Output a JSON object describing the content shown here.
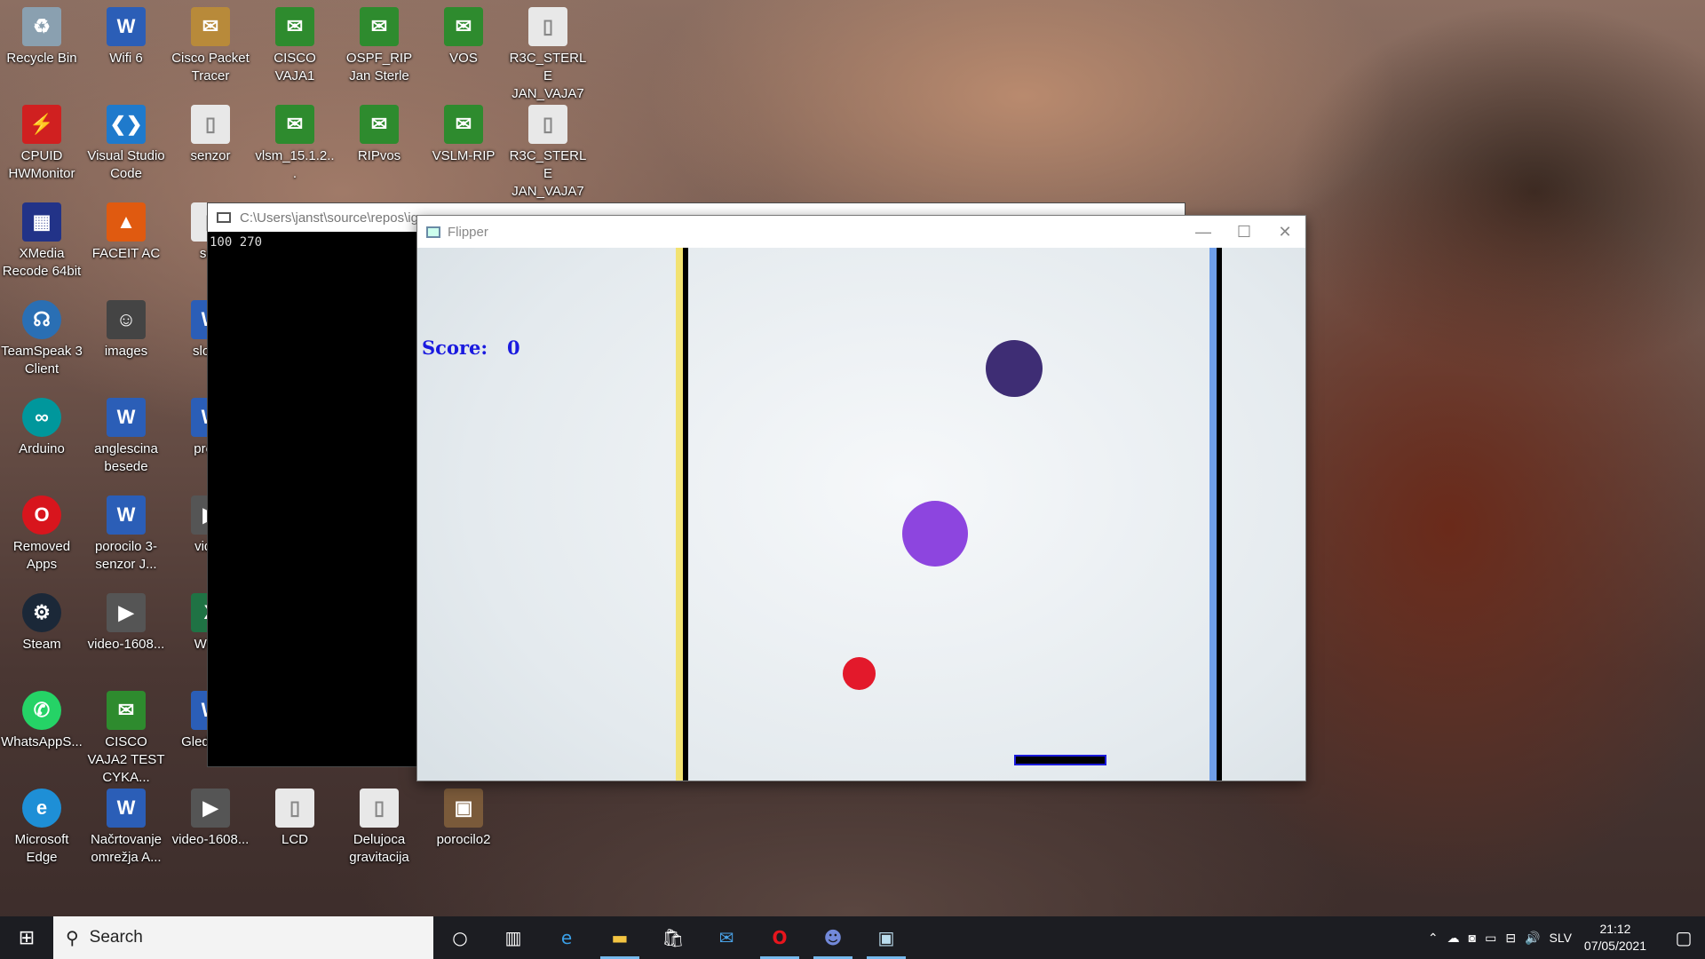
{
  "desktop": {
    "icons": [
      {
        "label": "Recycle Bin",
        "icon": "recycle-bin-icon",
        "color": "#8aa0b0"
      },
      {
        "label": "Wifi 6",
        "icon": "word-doc-icon",
        "color": "#2b5eb7"
      },
      {
        "label": "Cisco Packet Tracer",
        "icon": "packet-tracer-icon",
        "color": "#b88a3a"
      },
      {
        "label": "CISCO VAJA1",
        "icon": "packet-file-icon",
        "color": "#2e8b2e"
      },
      {
        "label": "OSPF_RIP Jan Sterle",
        "icon": "packet-file-icon",
        "color": "#2e8b2e"
      },
      {
        "label": "VOS",
        "icon": "packet-file-icon",
        "color": "#2e8b2e"
      },
      {
        "label": "R3C_STERLE JAN_VAJA7",
        "icon": "file-icon",
        "color": "#e8e8e8"
      },
      {
        "label": "CPUID HWMonitor",
        "icon": "hwmonitor-icon",
        "color": "#d02020"
      },
      {
        "label": "Visual Studio Code",
        "icon": "vscode-icon",
        "color": "#1f7acc"
      },
      {
        "label": "senzor",
        "icon": "file-icon",
        "color": "#e8e8e8"
      },
      {
        "label": "vlsm_15.1.2...",
        "icon": "packet-file-icon",
        "color": "#2e8b2e"
      },
      {
        "label": "RIPvos",
        "icon": "packet-file-icon",
        "color": "#2e8b2e"
      },
      {
        "label": "VSLM-RIP",
        "icon": "packet-file-icon",
        "color": "#2e8b2e"
      },
      {
        "label": "R3C_STERLE JAN_VAJA7",
        "icon": "file-icon",
        "color": "#e8e8e8"
      },
      {
        "label": "XMedia Recode 64bit",
        "icon": "film-icon",
        "color": "#223388"
      },
      {
        "label": "FACEIT AC",
        "icon": "faceit-icon",
        "color": "#e05a10"
      },
      {
        "label": "sen",
        "icon": "file-icon",
        "color": "#e8e8e8"
      },
      {
        "label": "TeamSpeak 3 Client",
        "icon": "teamspeak-icon",
        "color": "#2a6fb4"
      },
      {
        "label": "images",
        "icon": "image-icon",
        "color": "#444"
      },
      {
        "label": "slover",
        "icon": "word-doc-icon",
        "color": "#2b5eb7"
      },
      {
        "label": "Arduino",
        "icon": "arduino-icon",
        "color": "#00979c"
      },
      {
        "label": "anglescina besede",
        "icon": "word-doc-icon",
        "color": "#2b5eb7"
      },
      {
        "label": "preve",
        "icon": "word-doc-icon",
        "color": "#2b5eb7"
      },
      {
        "label": "Removed Apps",
        "icon": "opera-icon",
        "color": "#d8151d"
      },
      {
        "label": "porocilo 3-senzor J...",
        "icon": "word-doc-icon",
        "color": "#2b5eb7"
      },
      {
        "label": "video",
        "icon": "video-icon",
        "color": "#555"
      },
      {
        "label": "Steam",
        "icon": "steam-icon",
        "color": "#1b2838"
      },
      {
        "label": "video-1608...",
        "icon": "video-icon",
        "color": "#555"
      },
      {
        "label": "WOR",
        "icon": "excel-icon",
        "color": "#1f7244"
      },
      {
        "label": "WhatsAppS...",
        "icon": "whatsapp-icon",
        "color": "#25d366"
      },
      {
        "label": "CISCO VAJA2 TEST CYKA...",
        "icon": "packet-file-icon",
        "color": "#2e8b2e"
      },
      {
        "label": "Gled pred",
        "icon": "word-doc-icon",
        "color": "#2b5eb7"
      },
      {
        "label": "Microsoft Edge",
        "icon": "edge-icon",
        "color": "#1e8fd6"
      },
      {
        "label": "Načrtovanje omrežja A...",
        "icon": "word-doc-icon",
        "color": "#2b5eb7"
      },
      {
        "label": "video-1608...",
        "icon": "video-icon",
        "color": "#555"
      },
      {
        "label": "LCD",
        "icon": "file-icon",
        "color": "#e8e8e8"
      },
      {
        "label": "Delujoca gravitacija",
        "icon": "file-icon",
        "color": "#e8e8e8"
      },
      {
        "label": "porocilo2",
        "icon": "image-icon",
        "color": "#7a5a3a"
      }
    ]
  },
  "console": {
    "title": "C:\\Users\\janst\\source\\repos\\ig",
    "output": "100 270"
  },
  "flipper": {
    "title": "Flipper",
    "score_label": "Score:",
    "score_value": "0",
    "left_rail_colors": [
      "#f2e271",
      "#000000"
    ],
    "right_rail_colors": [
      "#6f9ee8",
      "#000000"
    ],
    "balls": [
      {
        "name": "dark-ball",
        "color": "#3e2d74"
      },
      {
        "name": "purple-ball",
        "color": "#8d45df"
      },
      {
        "name": "red-ball",
        "color": "#e3192b"
      }
    ],
    "paddle_color": "#0a0a6a"
  },
  "taskbar": {
    "search_placeholder": "Search",
    "language": "SLV",
    "time": "21:12",
    "date": "07/05/2021"
  }
}
